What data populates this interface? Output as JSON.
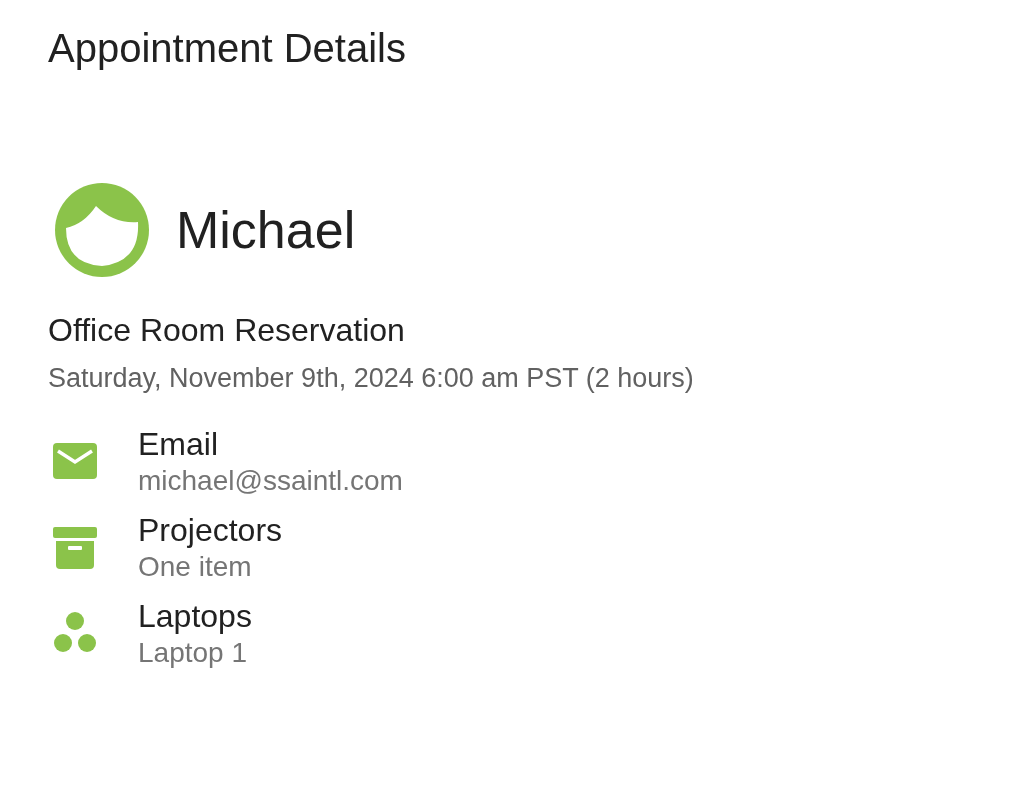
{
  "page": {
    "title": "Appointment Details"
  },
  "person": {
    "name": "Michael"
  },
  "appointment": {
    "title": "Office Room Reservation",
    "datetime": "Saturday, November 9th, 2024 6:00 am PST (2 hours)"
  },
  "details": [
    {
      "kind": "email",
      "label": "Email",
      "value": "michael@ssaintl.com"
    },
    {
      "kind": "archive",
      "label": "Projectors",
      "value": "One item"
    },
    {
      "kind": "group",
      "label": "Laptops",
      "value": "Laptop 1"
    }
  ]
}
